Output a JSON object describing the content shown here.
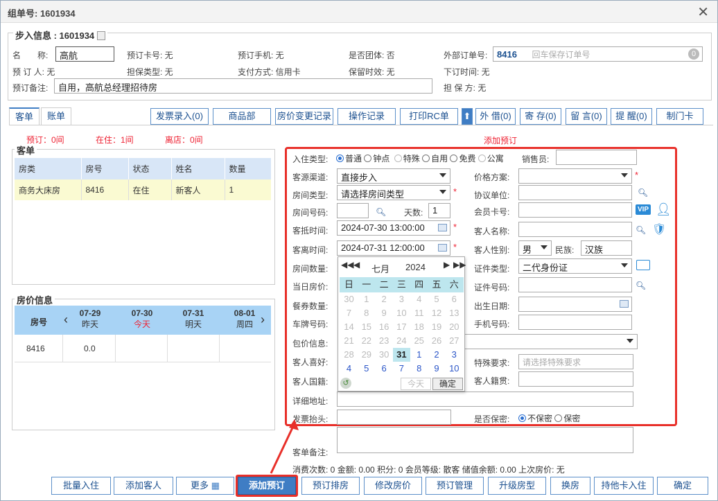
{
  "window": {
    "title": "组单号: 1601934"
  },
  "walkin": {
    "legend": "步入信息 : 1601934",
    "name_label": "名　　称:",
    "name_value": "高航",
    "booking_card_label": "预订卡号: 无",
    "booking_phone_label": "预订手机: 无",
    "group_label": "是否团体: 否",
    "external_label": "外部订单号:",
    "external_value": "8416",
    "external_placeholder": "回车保存订单号",
    "external_count": "0",
    "booker_label": "预 订 人: 无",
    "guarantee_type_label": "担保类型: 无",
    "pay_method_label": "支付方式: 信用卡",
    "keep_time_label": "保留时效: 无",
    "order_time_label": "下订时间: 无",
    "remark_label": "预订备注:",
    "remark_value": "自用，高航总经理招待房",
    "guarantor_label": "担 保 方: 无"
  },
  "tabs": [
    "客单",
    "账单"
  ],
  "toolbar": [
    "发票录入(0)",
    "商品部",
    "房价变更记录",
    "操作记录",
    "打印RC单",
    "外 借(0)",
    "寄 存(0)",
    "留 言(0)",
    "提 醒(0)",
    "制门卡"
  ],
  "stats": {
    "booked": "预订：0间",
    "checked_in": "在住：1间",
    "left": "离店：0间",
    "add_booking": "添加预订"
  },
  "guest_list": {
    "legend": "客单",
    "headers": [
      "房类",
      "房号",
      "状态",
      "姓名",
      "数量"
    ],
    "rows": [
      [
        "商务大床房",
        "8416",
        "在住",
        "新客人",
        "1"
      ]
    ]
  },
  "price_info": {
    "legend": "房价信息",
    "room_header": "房号",
    "days": [
      {
        "date": "07-29",
        "label": "昨天"
      },
      {
        "date": "07-30",
        "label": "今天"
      },
      {
        "date": "07-31",
        "label": "明天"
      },
      {
        "date": "08-01",
        "label": "周四"
      }
    ],
    "row": {
      "room": "8416",
      "price": "0.0"
    }
  },
  "form": {
    "checkin_type_label": "入住类型:",
    "checkin_types": [
      "普通",
      "钟点",
      "特殊",
      "自用",
      "免费",
      "公寓"
    ],
    "sales_label": "销售员:",
    "source_label": "客源渠道:",
    "source_value": "直接步入",
    "price_plan_label": "价格方案:",
    "room_type_label": "房间类型:",
    "room_type_value": "请选择房间类型",
    "agreement_label": "协议单位:",
    "room_no_label": "房间号码:",
    "days_label": "天数:",
    "days_value": "1",
    "member_label": "会员卡号:",
    "arrive_label": "客抵时间:",
    "arrive_value": "2024-07-30 13:00:00",
    "guest_name_label": "客人名称:",
    "depart_label": "客离时间:",
    "depart_value": "2024-07-31 12:00:00",
    "gender_label": "客人性别:",
    "gender_value": "男",
    "ethnic_label": "民族:",
    "ethnic_value": "汉族",
    "room_count_label": "房间数量:",
    "id_type_label": "证件类型:",
    "id_type_value": "二代身份证",
    "day_price_label": "当日房价:",
    "id_no_label": "证件号码:",
    "meal_label": "餐券数量:",
    "birthday_label": "出生日期:",
    "plate_label": "车牌号码:",
    "phone_label": "手机号码:",
    "package_label": "包价信息:",
    "preference_label": "客人喜好:",
    "special_label": "特殊要求:",
    "special_placeholder": "请选择特殊要求",
    "nationality_label": "客人国籍:",
    "native_label": "客人籍贯:",
    "address_label": "详细地址:",
    "invoice_label": "发票抬头:",
    "secret_label": "是否保密:",
    "secret_options": [
      "不保密",
      "保密"
    ],
    "remark_label": "客单备注:",
    "vip_label": "VIP"
  },
  "calendar": {
    "month": "七月",
    "year": "2024",
    "weekdays": [
      "日",
      "一",
      "二",
      "三",
      "四",
      "五",
      "六"
    ],
    "weeks": [
      [
        "30",
        "1",
        "2",
        "3",
        "4",
        "5",
        "6"
      ],
      [
        "7",
        "8",
        "9",
        "10",
        "11",
        "12",
        "13"
      ],
      [
        "14",
        "15",
        "16",
        "17",
        "18",
        "19",
        "20"
      ],
      [
        "21",
        "22",
        "23",
        "24",
        "25",
        "26",
        "27"
      ],
      [
        "28",
        "29",
        "30",
        "31",
        "1",
        "2",
        "3"
      ],
      [
        "4",
        "5",
        "6",
        "7",
        "8",
        "9",
        "10"
      ]
    ],
    "today_label": "今天",
    "ok_label": "确定"
  },
  "footer_info": {
    "consume": "消费次数: 0",
    "amount": "金额: 0.00",
    "points": "积分: 0",
    "member_level": "会员等级: 散客",
    "balance": "储值余额: 0.00",
    "last_price": "上次房价: 无"
  },
  "bottom_buttons": [
    "批量入住",
    "添加客人",
    "更多",
    "添加预订",
    "预订排房",
    "修改房价",
    "预订管理",
    "升级房型",
    "换房",
    "持他卡入住",
    "确定"
  ]
}
